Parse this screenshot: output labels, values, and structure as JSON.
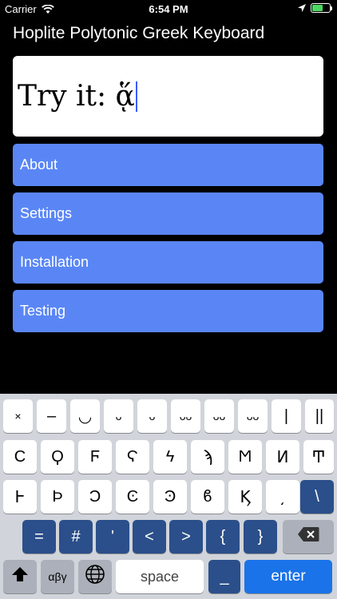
{
  "status_bar": {
    "carrier": "Carrier",
    "time": "6:54 PM",
    "battery_level": 0.6,
    "battery_color": "#4cd964"
  },
  "app_title": "Hoplite Polytonic Greek Keyboard",
  "try_box": {
    "text": "Try it: ᾅ"
  },
  "menu": {
    "items": [
      {
        "label": "About"
      },
      {
        "label": "Settings"
      },
      {
        "label": "Installation"
      },
      {
        "label": "Testing"
      }
    ],
    "color": "#5a86f5"
  },
  "keyboard": {
    "row1": [
      "×",
      "–",
      "◡",
      "ᴗ",
      "ᴗ",
      "ᴗᴗ",
      "ᴗᴗ",
      "ᴗᴗ",
      "|",
      "||"
    ],
    "row2": [
      "Ϲ",
      "Ϙ",
      "Ϝ",
      "Ϛ",
      "ϟ",
      "ϡ",
      "Ϻ",
      "Ͷ",
      "Ͳ"
    ],
    "row3": [
      "Ͱ",
      "Ϸ",
      "Ͻ",
      "Ͼ",
      "Ͽ",
      "ϐ",
      "Ϗ",
      "͵",
      "\\"
    ],
    "row4": [
      "=",
      "#",
      "'",
      "<",
      ">",
      "{",
      "}"
    ],
    "shift_icon": "shift-arrow-icon",
    "backspace_icon": "backspace-icon",
    "globe_icon": "globe-icon",
    "greek_label": "αβγ",
    "space_label": "space",
    "underscore_label": "_",
    "enter_label": "enter"
  }
}
